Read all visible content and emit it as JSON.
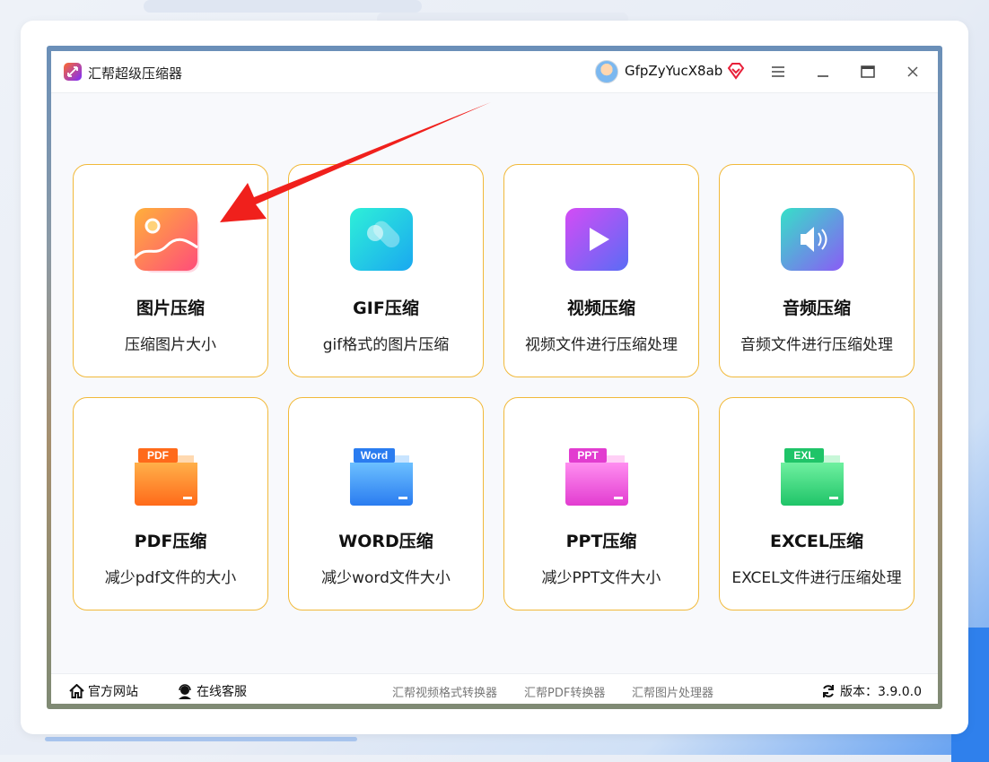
{
  "window": {
    "title": "汇帮超级压缩器",
    "username": "GfpZyYucX8ab"
  },
  "tiles": [
    {
      "title": "图片压缩",
      "desc": "压缩图片大小",
      "icon": "image-icon"
    },
    {
      "title": "GIF压缩",
      "desc": "gif格式的图片压缩",
      "icon": "gif-icon"
    },
    {
      "title": "视频压缩",
      "desc": "视频文件进行压缩处理",
      "icon": "video-play-icon"
    },
    {
      "title": "音频压缩",
      "desc": "音频文件进行压缩处理",
      "icon": "audio-speaker-icon"
    },
    {
      "title": "PDF压缩",
      "desc": "减少pdf文件的大小",
      "icon": "pdf-folder-icon",
      "badge": "PDF"
    },
    {
      "title": "WORD压缩",
      "desc": "减少word文件大小",
      "icon": "word-folder-icon",
      "badge": "Word"
    },
    {
      "title": "PPT压缩",
      "desc": "减少PPT文件大小",
      "icon": "ppt-folder-icon",
      "badge": "PPT"
    },
    {
      "title": "EXCEL压缩",
      "desc": "EXCEL文件进行压缩处理",
      "icon": "excel-folder-icon",
      "badge": "EXL"
    }
  ],
  "footer": {
    "website": "官方网站",
    "support": "在线客服",
    "links": [
      "汇帮视频格式转换器",
      "汇帮PDF转换器",
      "汇帮图片处理器"
    ],
    "version": "版本：3.9.0.0"
  },
  "colors": {
    "tile_border": "#f1b93a",
    "annotation_arrow": "#f0201c"
  }
}
